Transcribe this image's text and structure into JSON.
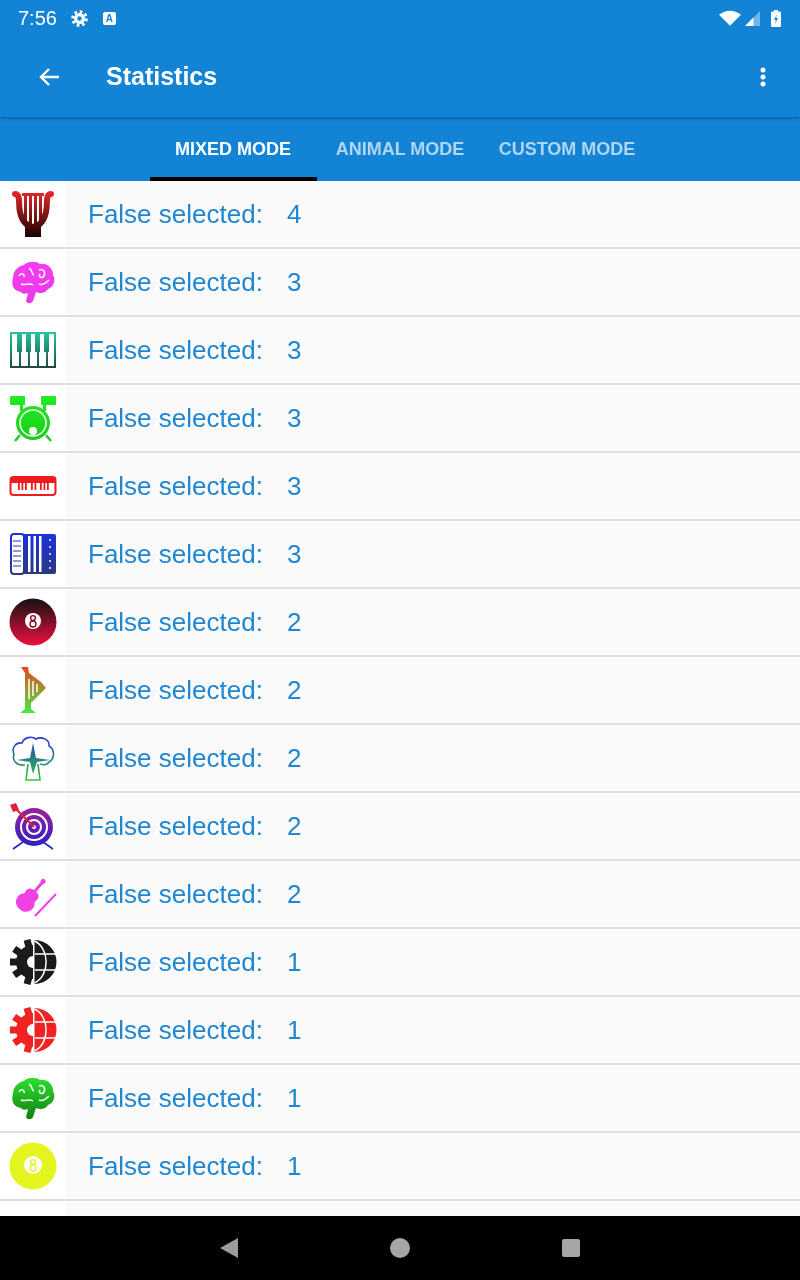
{
  "status_bar": {
    "time": "7:56",
    "notification_badge": "A"
  },
  "app_bar": {
    "title": "Statistics"
  },
  "tabs": [
    {
      "label": "MIXED MODE",
      "selected": true
    },
    {
      "label": "ANIMAL MODE",
      "selected": false
    },
    {
      "label": "CUSTOM MODE",
      "selected": false
    }
  ],
  "rows": [
    {
      "label": "False selected:",
      "count": "4"
    },
    {
      "label": "False selected:",
      "count": "3"
    },
    {
      "label": "False selected:",
      "count": "3"
    },
    {
      "label": "False selected:",
      "count": "3"
    },
    {
      "label": "False selected:",
      "count": "3"
    },
    {
      "label": "False selected:",
      "count": "3"
    },
    {
      "label": "False selected:",
      "count": "2"
    },
    {
      "label": "False selected:",
      "count": "2"
    },
    {
      "label": "False selected:",
      "count": "2"
    },
    {
      "label": "False selected:",
      "count": "2"
    },
    {
      "label": "False selected:",
      "count": "2"
    },
    {
      "label": "False selected:",
      "count": "1"
    },
    {
      "label": "False selected:",
      "count": "1"
    },
    {
      "label": "False selected:",
      "count": "1"
    },
    {
      "label": "False selected:",
      "count": "1"
    }
  ]
}
